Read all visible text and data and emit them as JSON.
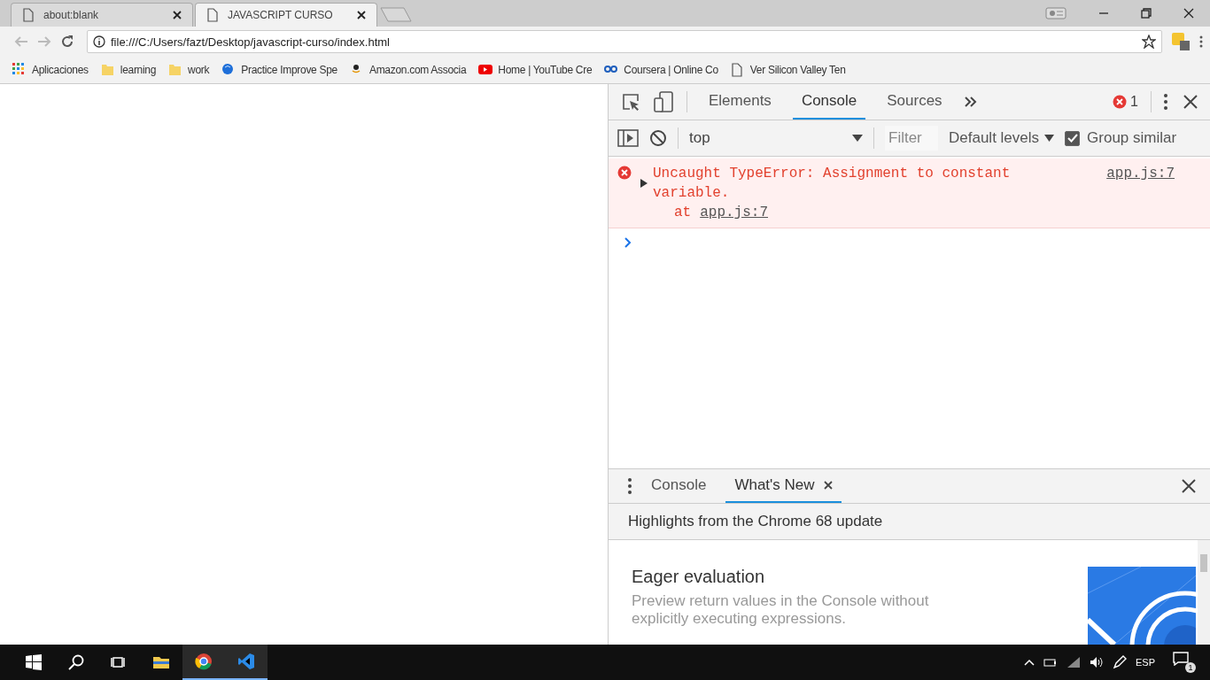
{
  "browser_tabs": [
    {
      "title": "about:blank",
      "selected": false
    },
    {
      "title": "JAVASCRIPT CURSO",
      "selected": true
    }
  ],
  "address_bar": {
    "url": "file:///C:/Users/fazt/Desktop/javascript-curso/index.html"
  },
  "bookmarks": [
    {
      "label": "Aplicaciones",
      "kind": "apps"
    },
    {
      "label": "learning",
      "kind": "folder"
    },
    {
      "label": "work",
      "kind": "folder"
    },
    {
      "label": "Practice Improve Spe",
      "kind": "globe"
    },
    {
      "label": "Amazon.com Associa",
      "kind": "amazon"
    },
    {
      "label": "Home | YouTube Cre",
      "kind": "youtube"
    },
    {
      "label": "Coursera | Online Co",
      "kind": "link"
    },
    {
      "label": "Ver Silicon Valley Ten",
      "kind": "page"
    }
  ],
  "devtools": {
    "tabs": [
      {
        "label": "Elements",
        "selected": false
      },
      {
        "label": "Console",
        "selected": true
      },
      {
        "label": "Sources",
        "selected": false
      }
    ],
    "error_count": "1",
    "console_toolbar": {
      "context": "top",
      "filter_placeholder": "Filter",
      "levels": "Default levels",
      "group_similar": {
        "label": "Group similar",
        "checked": true
      }
    },
    "messages": [
      {
        "kind": "error",
        "text": "Uncaught TypeError: Assignment to constant variable.",
        "trace_prefix": "at",
        "trace_link": "app.js:7",
        "source": "app.js:7"
      }
    ],
    "drawer": {
      "tabs": [
        {
          "label": "Console",
          "selected": false,
          "closable": false
        },
        {
          "label": "What's New",
          "selected": true,
          "closable": true
        }
      ],
      "header": "Highlights from the Chrome 68 update",
      "article": {
        "title": "Eager evaluation",
        "body": "Preview return values in the Console without explicitly executing expressions."
      }
    }
  },
  "taskbar": {
    "apps": [
      {
        "kind": "explorer",
        "active": false
      },
      {
        "kind": "chrome",
        "active": true
      },
      {
        "kind": "vscode",
        "active": true
      }
    ],
    "language": "ESP",
    "notification_count": "1"
  }
}
